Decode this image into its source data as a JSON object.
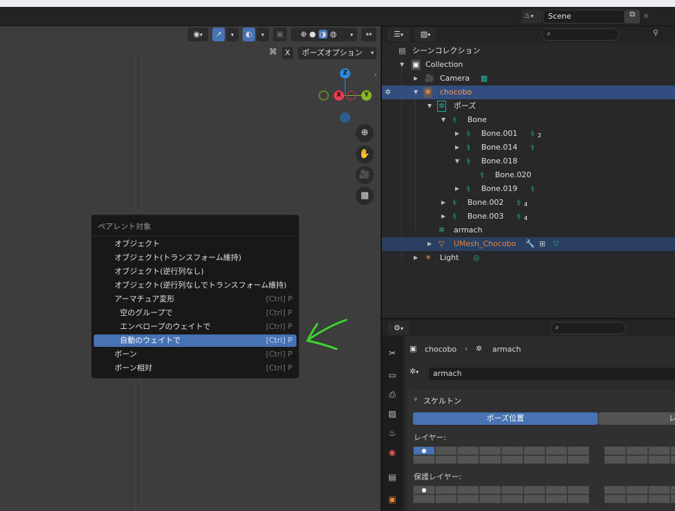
{
  "header": {
    "scene_label": "Scene",
    "scene_icon": "scene-icon",
    "copy_icon": "copy-icon",
    "close_icon": "close-icon"
  },
  "viewport": {
    "close_x_label": "X",
    "pose_options_label": "ポーズオプション",
    "gizmo": {
      "z": "Z",
      "x": "X",
      "y": "Y"
    },
    "colors": {
      "x": "#e83d50",
      "y": "#8ab625",
      "z": "#2c8ade",
      "neg_x": "#8b3a46",
      "neg_y": "#6a7f2a",
      "neg_z": "#2e5f92"
    }
  },
  "menu": {
    "title": "ペアレント対象",
    "items": [
      {
        "label": "オブジェクト",
        "shortcut": ""
      },
      {
        "label": "オブジェクト(トランスフォーム維持)",
        "shortcut": ""
      },
      {
        "label": "オブジェクト(逆行列なし)",
        "shortcut": ""
      },
      {
        "label": "オブジェクト(逆行列なしでトランスフォーム維持)",
        "shortcut": ""
      },
      {
        "label": "アーマチュア変形",
        "shortcut": "[Ctrl] P"
      },
      {
        "label": "空のグループで",
        "shortcut": "[Ctrl] P"
      },
      {
        "label": "エンベロープのウェイトで",
        "shortcut": "[Ctrl] P"
      },
      {
        "label": "自動のウェイトで",
        "shortcut": "[Ctrl] P"
      },
      {
        "label": "ボーン",
        "shortcut": "[Ctrl] P"
      },
      {
        "label": "ボーン相対",
        "shortcut": "[Ctrl] P"
      }
    ],
    "selected_index": 7,
    "accent": "#4772b3"
  },
  "annotation": {
    "arrow_color": "#3cd62a"
  },
  "outliner": {
    "rows": [
      {
        "name": "シーンコレクション"
      },
      {
        "name": "Collection"
      },
      {
        "name": "Camera"
      },
      {
        "name": "chocobo"
      },
      {
        "name": "ポーズ"
      },
      {
        "name": "Bone"
      },
      {
        "name": "Bone.001",
        "badge": "2"
      },
      {
        "name": "Bone.014"
      },
      {
        "name": "Bone.018"
      },
      {
        "name": "Bone.020"
      },
      {
        "name": "Bone.019"
      },
      {
        "name": "Bone.002",
        "badge": "4"
      },
      {
        "name": "Bone.003",
        "badge": "4"
      },
      {
        "name": "armach"
      },
      {
        "name": "UMesh_Chocobo"
      },
      {
        "name": "Light"
      }
    ],
    "object_color": "#e8853a",
    "bone_color": "#1db39b"
  },
  "properties": {
    "breadcrumb": {
      "object": "chocobo",
      "data": "armach"
    },
    "datablock_name": "armach",
    "panel_title": "スケルトン",
    "pose_position_label": "ポーズ位置",
    "rest_position_label": "レ",
    "layers_label": "レイヤー:",
    "protected_layers_label": "保護レイヤー:"
  }
}
